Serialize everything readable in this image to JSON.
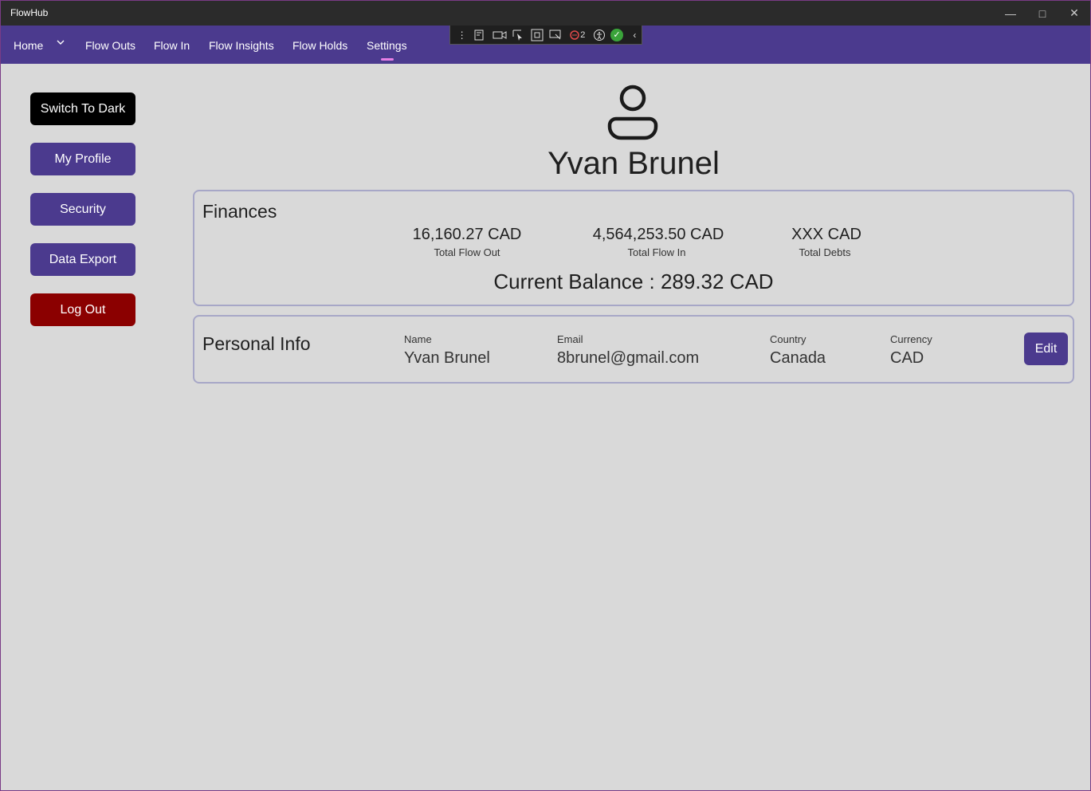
{
  "window": {
    "title": "FlowHub"
  },
  "nav": {
    "home": "Home",
    "flow_outs": "Flow Outs",
    "flow_in": "Flow In",
    "flow_insights": "Flow Insights",
    "flow_holds": "Flow Holds",
    "settings": "Settings",
    "active": "Settings"
  },
  "debug_toolbar": {
    "binding_failures": "2"
  },
  "sidebar": {
    "switch_theme": "Switch To Dark",
    "my_profile": "My Profile",
    "security": "Security",
    "data_export": "Data Export",
    "log_out": "Log Out"
  },
  "profile": {
    "name": "Yvan Brunel"
  },
  "finances": {
    "title": "Finances",
    "total_flow_out_value": "16,160.27 CAD",
    "total_flow_out_label": "Total Flow Out",
    "total_flow_in_value": "4,564,253.50 CAD",
    "total_flow_in_label": "Total Flow In",
    "total_debts_value": "XXX CAD",
    "total_debts_label": "Total Debts",
    "current_balance": "Current Balance : 289.32 CAD"
  },
  "personal_info": {
    "title": "Personal Info",
    "name_label": "Name",
    "name_value": "Yvan Brunel",
    "email_label": "Email",
    "email_value": "8brunel@gmail.com",
    "country_label": "Country",
    "country_value": "Canada",
    "currency_label": "Currency",
    "currency_value": "CAD",
    "edit_label": "Edit"
  },
  "colors": {
    "accent": "#4b3a8e",
    "danger": "#8b0000",
    "nav_indicator": "#e77fe6",
    "background": "#d9d9d9"
  }
}
